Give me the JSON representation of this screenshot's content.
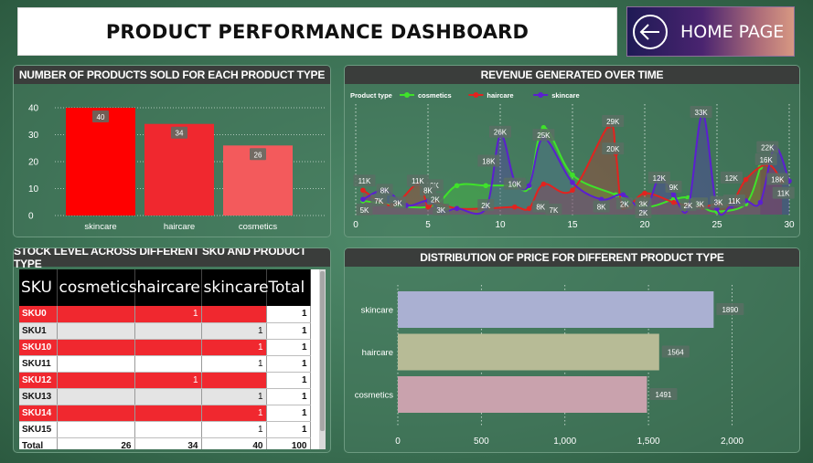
{
  "header": {
    "title": "PRODUCT PERFORMANCE DASHBOARD",
    "home_label": "HOME PAGE",
    "home_icon": "arrow-left-circle-icon"
  },
  "panels": {
    "sold": "NUMBER OF PRODUCTS SOLD FOR EACH PRODUCT TYPE",
    "revenue": "REVENUE GENERATED OVER TIME",
    "stock": "STOCK LEVEL ACROSS DIFFERENT SKU AND PRODUCT TYPE",
    "price": "DISTRIBUTION OF PRICE FOR DIFFERENT PRODUCT TYPE"
  },
  "chart_data": [
    {
      "type": "bar",
      "categories": [
        "skincare",
        "haircare",
        "cosmetics"
      ],
      "values": [
        40,
        34,
        26
      ],
      "ylim": [
        0,
        40
      ],
      "yticks": [
        0,
        10,
        20,
        30,
        40
      ],
      "colors": [
        "#ff0000",
        "#f0282f",
        "#f35a5c"
      ],
      "grid": true
    },
    {
      "type": "area",
      "legend_title": "Product type",
      "legend_position": "top-left",
      "xlim": [
        0,
        30
      ],
      "xticks": [
        0,
        5,
        10,
        15,
        20,
        25,
        30
      ],
      "ylim": [
        0,
        35000
      ],
      "series": [
        {
          "name": "cosmetics",
          "color": "#3fe22a",
          "x": [
            0.5,
            5,
            7,
            9,
            11,
            12,
            13,
            15,
            18,
            20,
            22,
            23,
            24,
            25,
            27,
            28
          ],
          "y": [
            4500,
            2500,
            9500,
            9500,
            9500,
            9000,
            28500,
            13000,
            6500,
            2500,
            5000,
            5500,
            2500,
            1000,
            3500,
            15500
          ],
          "labels": [
            {
              "x": 5.3,
              "y": 9500,
              "t": "10K"
            },
            {
              "x": 9.2,
              "y": 17500,
              "t": "18K"
            }
          ]
        },
        {
          "name": "haircare",
          "color": "#e2231f",
          "x": [
            0.5,
            2.5,
            4.3,
            5,
            5.5,
            7,
            9,
            11,
            12,
            13,
            15,
            17.5,
            18,
            18.5,
            20,
            22,
            23,
            24,
            25,
            26,
            27,
            28.5,
            29.5
          ],
          "y": [
            8000,
            3000,
            10000,
            2500,
            4000,
            2000,
            2000,
            2500,
            2000,
            10000,
            8000,
            29000,
            20000,
            2500,
            7000,
            4000,
            3000,
            2500,
            3500,
            3500,
            11500,
            16500,
            11000
          ],
          "labels": [
            {
              "x": 1.6,
              "y": 4500,
              "t": "7K"
            },
            {
              "x": 4.3,
              "y": 11000,
              "t": "11K"
            },
            {
              "x": 5.5,
              "y": 5000,
              "t": "2K"
            },
            {
              "x": 9,
              "y": 3000,
              "t": "2K"
            },
            {
              "x": 12.8,
              "y": 2500,
              "t": "8K"
            },
            {
              "x": 13.7,
              "y": 1500,
              "t": "7K"
            },
            {
              "x": 17,
              "y": 2500,
              "t": "8K"
            },
            {
              "x": 17.8,
              "y": 30500,
              "t": "29K"
            },
            {
              "x": 17.8,
              "y": 21500,
              "t": "20K"
            },
            {
              "x": 23.8,
              "y": 3500,
              "t": "3K"
            },
            {
              "x": 25.1,
              "y": 4000,
              "t": "3K"
            },
            {
              "x": 26.2,
              "y": 4500,
              "t": "11K"
            },
            {
              "x": 26,
              "y": 12000,
              "t": "12K"
            },
            {
              "x": 28.4,
              "y": 18000,
              "t": "16K"
            },
            {
              "x": 29.2,
              "y": 11500,
              "t": "18K"
            }
          ]
        },
        {
          "name": "skincare",
          "color": "#5b1fd0",
          "x": [
            0.5,
            2,
            3.5,
            5,
            6,
            7,
            9,
            10,
            11,
            12,
            13,
            15,
            17,
            18.5,
            20,
            21,
            22,
            23,
            24,
            25,
            26,
            27,
            28,
            29,
            30
          ],
          "y": [
            5000,
            8000,
            3000,
            4500,
            1000,
            2000,
            2000,
            26000,
            11000,
            9500,
            25000,
            10500,
            5000,
            6500,
            1500,
            12000,
            6500,
            2000,
            33000,
            2000,
            3000,
            4500,
            4000,
            22000,
            11000
          ],
          "labels": [
            {
              "x": 0.6,
              "y": 11000,
              "t": "11K"
            },
            {
              "x": 0.6,
              "y": 1500,
              "t": "5K"
            },
            {
              "x": 2,
              "y": 8000,
              "t": "8K"
            },
            {
              "x": 2.9,
              "y": 3800,
              "t": "3K"
            },
            {
              "x": 5,
              "y": 8000,
              "t": "8K"
            },
            {
              "x": 5.9,
              "y": 1500,
              "t": "3K"
            },
            {
              "x": 10,
              "y": 27000,
              "t": "26K"
            },
            {
              "x": 11,
              "y": 10000,
              "t": "10K"
            },
            {
              "x": 13,
              "y": 26000,
              "t": "25K"
            },
            {
              "x": 18.6,
              "y": 3500,
              "t": "2K"
            },
            {
              "x": 19.9,
              "y": 3500,
              "t": "3K"
            },
            {
              "x": 19.9,
              "y": 500,
              "t": "2K"
            },
            {
              "x": 21,
              "y": 12000,
              "t": "12K"
            },
            {
              "x": 22,
              "y": 9000,
              "t": "9K"
            },
            {
              "x": 23.9,
              "y": 33500,
              "t": "33K"
            },
            {
              "x": 23,
              "y": 3000,
              "t": "2K"
            },
            {
              "x": 28.5,
              "y": 22000,
              "t": "22K"
            },
            {
              "x": 29.6,
              "y": 7000,
              "t": "11K"
            }
          ]
        }
      ]
    },
    {
      "type": "table",
      "columns": [
        "SKU",
        "cosmetics",
        "haircare",
        "skincare",
        "Total"
      ],
      "rows": [
        {
          "sku": "SKU0",
          "cosmetics": "",
          "haircare": "1",
          "skincare": "",
          "total": "1",
          "style": "red"
        },
        {
          "sku": "SKU1",
          "cosmetics": "",
          "haircare": "",
          "skincare": "1",
          "total": "1",
          "style": "gray"
        },
        {
          "sku": "SKU10",
          "cosmetics": "",
          "haircare": "",
          "skincare": "1",
          "total": "1",
          "style": "red"
        },
        {
          "sku": "SKU11",
          "cosmetics": "",
          "haircare": "",
          "skincare": "1",
          "total": "1",
          "style": "white"
        },
        {
          "sku": "SKU12",
          "cosmetics": "",
          "haircare": "1",
          "skincare": "",
          "total": "1",
          "style": "red"
        },
        {
          "sku": "SKU13",
          "cosmetics": "",
          "haircare": "",
          "skincare": "1",
          "total": "1",
          "style": "gray"
        },
        {
          "sku": "SKU14",
          "cosmetics": "",
          "haircare": "",
          "skincare": "1",
          "total": "1",
          "style": "red"
        },
        {
          "sku": "SKU15",
          "cosmetics": "",
          "haircare": "",
          "skincare": "1",
          "total": "1",
          "style": "white"
        }
      ],
      "totals": {
        "label": "Total",
        "cosmetics": "26",
        "haircare": "34",
        "skincare": "40",
        "total": "100"
      }
    },
    {
      "type": "bar",
      "orientation": "horizontal",
      "categories": [
        "skincare",
        "haircare",
        "cosmetics"
      ],
      "values": [
        1890,
        1564,
        1491
      ],
      "colors": [
        "#aab0d2",
        "#b7bb96",
        "#c9a2ad"
      ],
      "xlim": [
        0,
        2200
      ],
      "xticks": [
        0,
        500,
        1000,
        1500,
        2000
      ],
      "xtick_labels": [
        "0",
        "500",
        "1,000",
        "1,500",
        "2,000"
      ]
    }
  ]
}
